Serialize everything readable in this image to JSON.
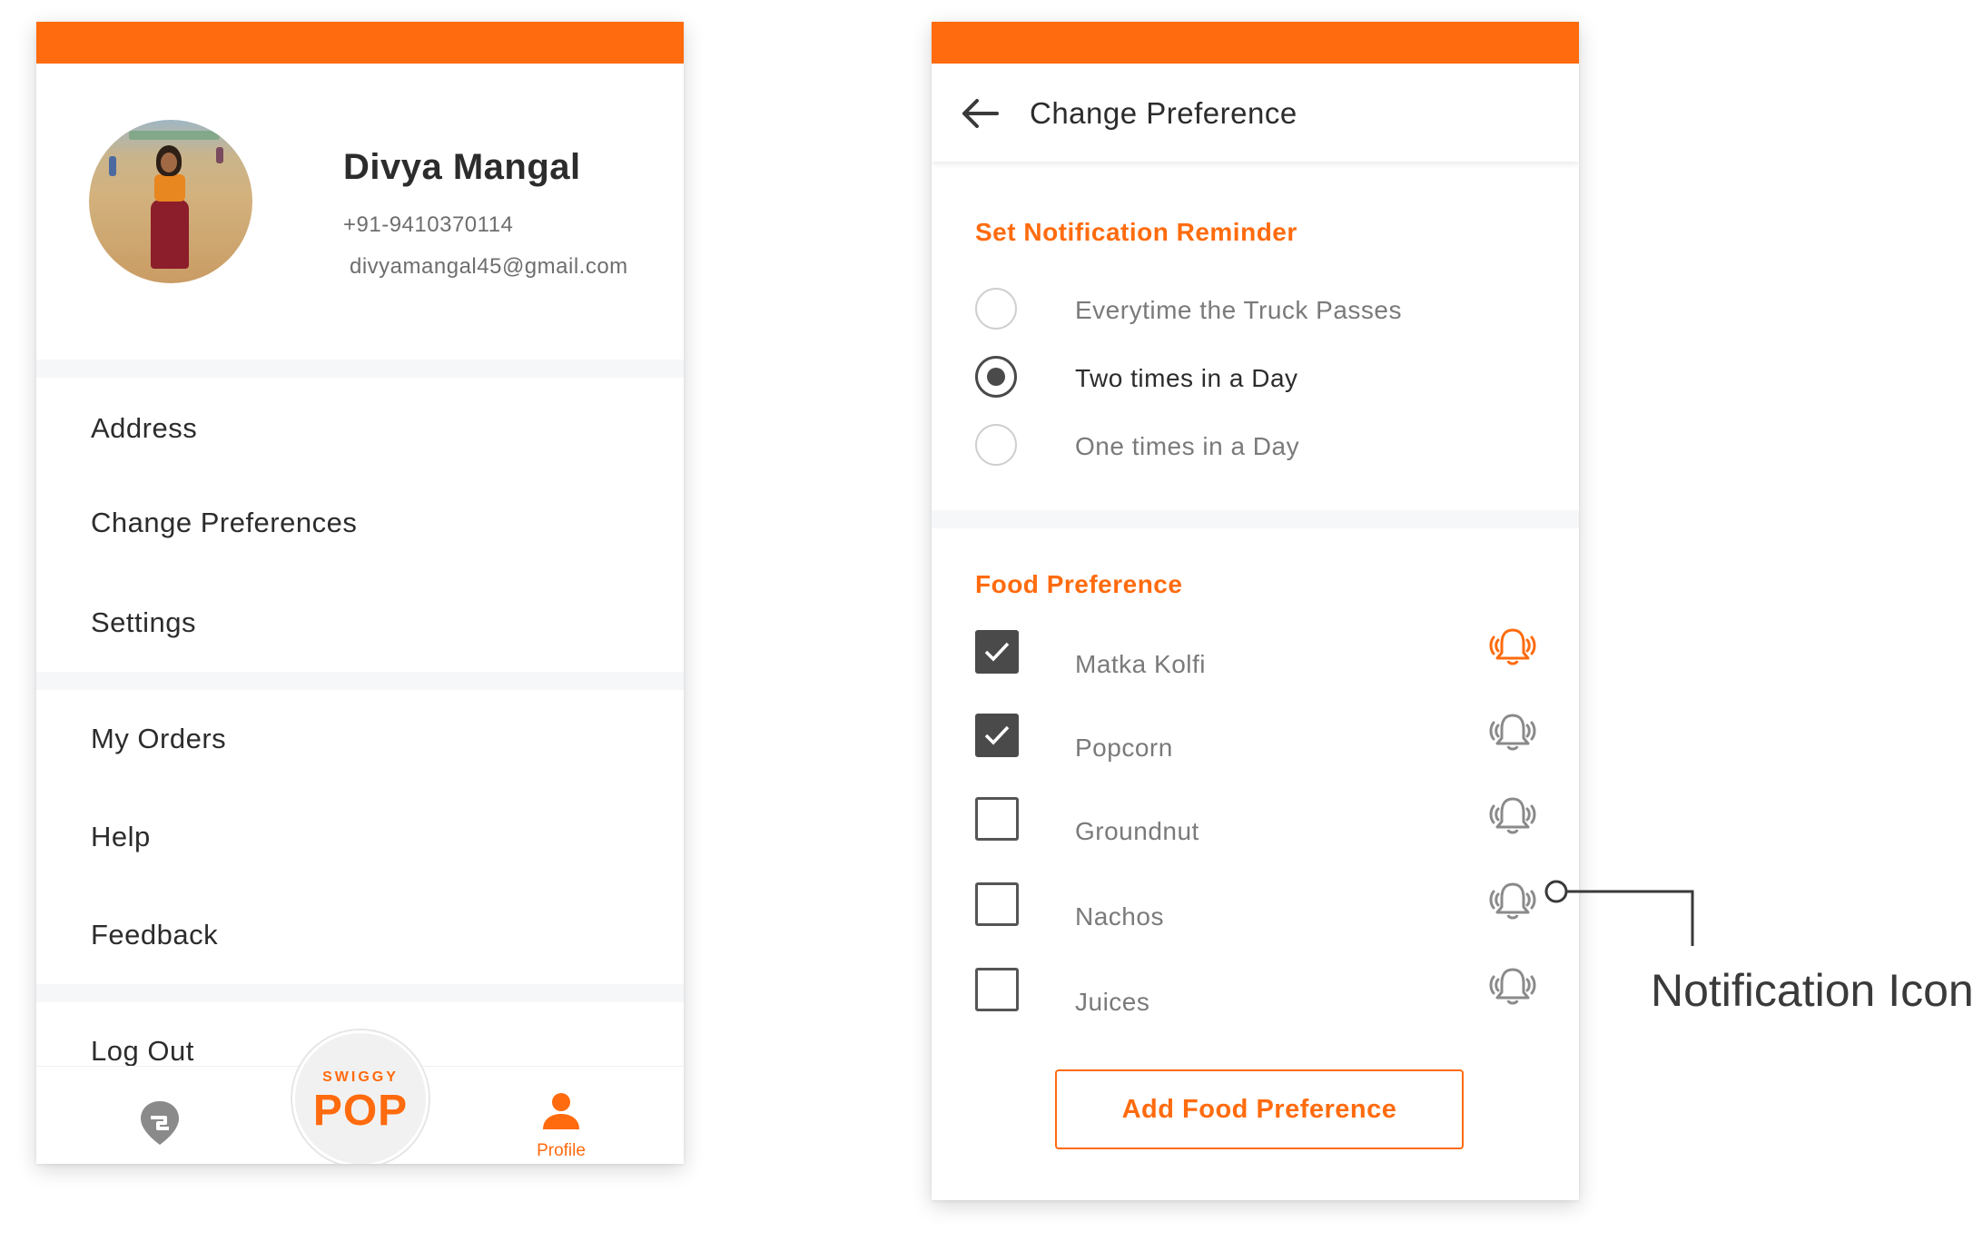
{
  "profile_screen": {
    "user": {
      "name": "Divya Mangal",
      "phone": "+91-9410370114",
      "email": "divyamangal45@gmail.com"
    },
    "menu_group_1": [
      "Address",
      "Change Preferences",
      "Settings"
    ],
    "menu_group_2": [
      "My Orders",
      "Help",
      "Feedback"
    ],
    "logout_label": "Log Out",
    "bottom_nav": {
      "home_icon": "swiggy-logo-icon",
      "center_small": "SWIGGY",
      "center_big": "POP",
      "profile_label": "Profile",
      "profile_icon": "person-icon"
    }
  },
  "preference_screen": {
    "title": "Change Preference",
    "back_icon": "arrow-left-icon",
    "notification_section": {
      "title": "Set Notification Reminder",
      "options": [
        {
          "label": "Everytime the Truck Passes",
          "selected": false
        },
        {
          "label": "Two times in a Day",
          "selected": true
        },
        {
          "label": "One times in a Day",
          "selected": false
        }
      ]
    },
    "food_section": {
      "title": "Food Preference",
      "items": [
        {
          "label": "Matka Kolfi",
          "checked": true,
          "bell_active": true
        },
        {
          "label": "Popcorn",
          "checked": true,
          "bell_active": false
        },
        {
          "label": "Groundnut",
          "checked": false,
          "bell_active": false
        },
        {
          "label": "Nachos",
          "checked": false,
          "bell_active": false
        },
        {
          "label": "Juices",
          "checked": false,
          "bell_active": false
        }
      ],
      "add_button": "Add Food Preference"
    }
  },
  "annotation": {
    "label": "Notification Icon"
  },
  "colors": {
    "accent": "#ff6b0e",
    "text_dark": "#2c2c2c",
    "text_muted": "#7a7a7a",
    "control_dark": "#4a4a4a"
  }
}
